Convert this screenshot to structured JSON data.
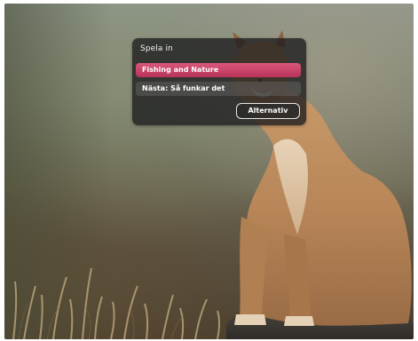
{
  "dialog": {
    "title": "Spela in",
    "options": [
      {
        "label": "Fishing and Nature",
        "selected": true
      },
      {
        "label": "Nästa: Så funkar det",
        "selected": false
      }
    ],
    "button_label": "Alternativ"
  },
  "colors": {
    "accent": "#c84068",
    "dialog_background": "#1c1c1e"
  }
}
